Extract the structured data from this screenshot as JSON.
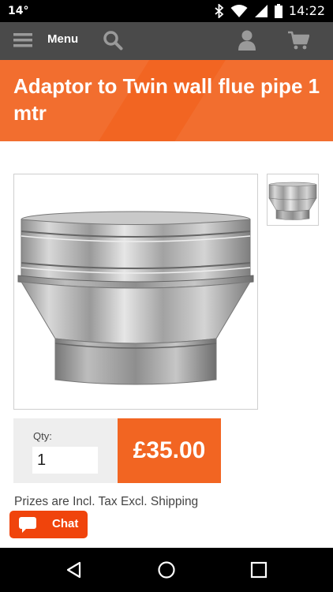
{
  "status_bar": {
    "temperature": "14°",
    "time": "14:22",
    "icons": [
      "bluetooth-icon",
      "wifi-icon",
      "cell-signal-icon",
      "battery-icon"
    ]
  },
  "header": {
    "menu_label": "Menu",
    "icons": [
      "hamburger-menu-icon",
      "search-icon",
      "user-account-icon",
      "shopping-cart-icon"
    ]
  },
  "product": {
    "title": "Adaptor to Twin wall flue pipe 1 mtr",
    "qty_label": "Qty:",
    "qty_value": "1",
    "price": "£35.00",
    "tax_note": "Prizes are Incl. Tax Excl. Shipping"
  },
  "chat": {
    "label": "Chat",
    "icon": "chat-bubble-icon"
  },
  "colors": {
    "accent": "#f26522",
    "chat": "#f0440c",
    "header": "#4a4a4a"
  }
}
